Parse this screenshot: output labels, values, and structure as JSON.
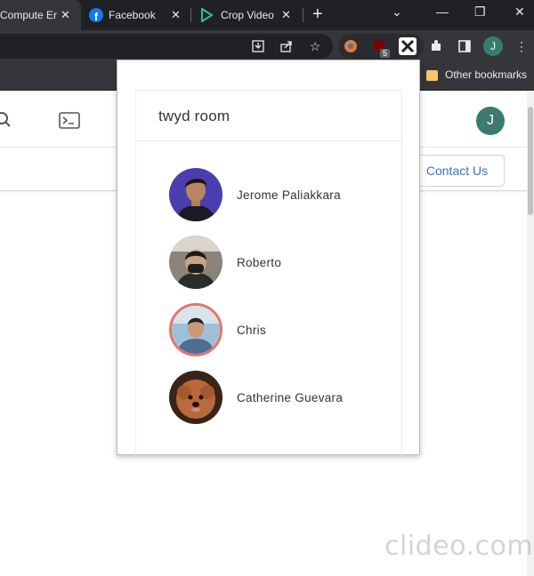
{
  "browser": {
    "tabs": [
      {
        "title": "Compute Er",
        "active": true
      },
      {
        "title": "Facebook",
        "icon": "facebook-icon"
      },
      {
        "title": "Crop Video",
        "icon": "play-icon"
      }
    ],
    "extension_badge": "5",
    "profile_initial": "J"
  },
  "bookmarks": {
    "other_label": "Other bookmarks"
  },
  "page": {
    "contact_button": "Contact Us",
    "avatar_initial": "J"
  },
  "popup": {
    "room_name": "twyd room",
    "members": [
      {
        "name": "Jerome Paliakkara",
        "avatar": "photo-avatar"
      },
      {
        "name": "Roberto",
        "avatar": "photo-avatar"
      },
      {
        "name": "Chris",
        "avatar": "photo-avatar-highlighted",
        "highlight_color": "#e8736a"
      },
      {
        "name": "Catherine Guevara",
        "avatar": "photo-avatar"
      }
    ]
  },
  "watermark": "clideo.com",
  "colors": {
    "accent_blue": "#3c6fd1",
    "avatar_green": "#3b7a6e",
    "highlight_ring": "#e8736a"
  }
}
